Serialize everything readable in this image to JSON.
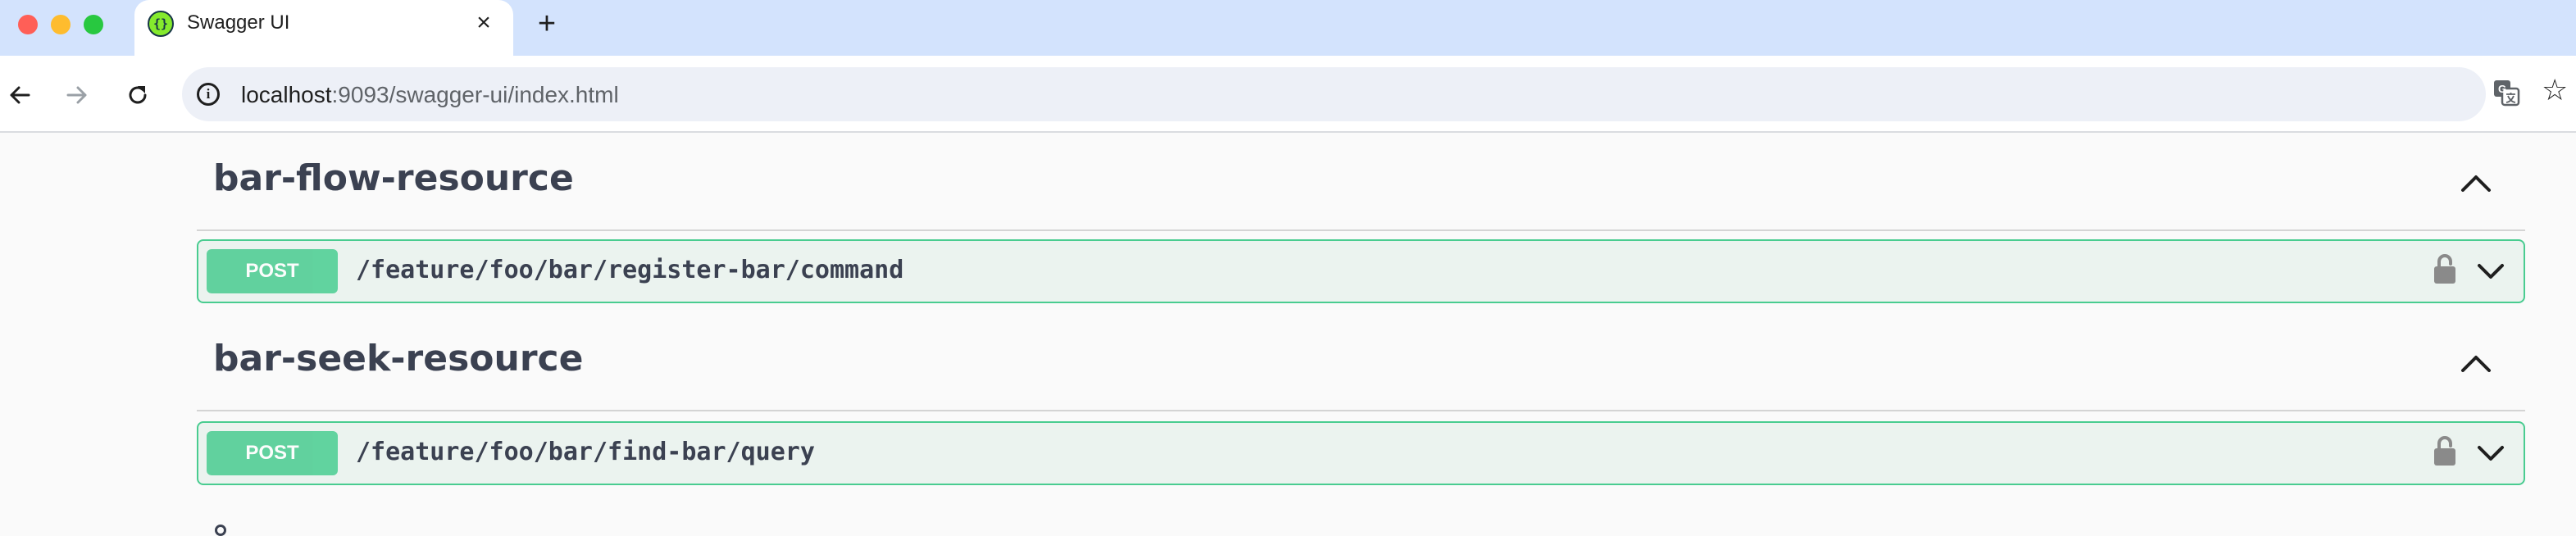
{
  "browser": {
    "tab": {
      "title": "Swagger UI",
      "favicon": "swagger-icon",
      "close": "×"
    },
    "new_tab": "+",
    "url_host": "localhost",
    "url_rest": ":9093/swagger-ui/index.html"
  },
  "tags": [
    {
      "name": "bar-flow-resource",
      "operations": [
        {
          "method": "POST",
          "path": "/feature/foo/bar/register-bar/command"
        }
      ]
    },
    {
      "name": "bar-seek-resource",
      "operations": [
        {
          "method": "POST",
          "path": "/feature/foo/bar/find-bar/query"
        }
      ]
    }
  ],
  "colors": {
    "post": "#49cc90",
    "post_bg": "#ebf3ef",
    "tab_strip": "#d3e3fd",
    "text": "#3b4151"
  }
}
